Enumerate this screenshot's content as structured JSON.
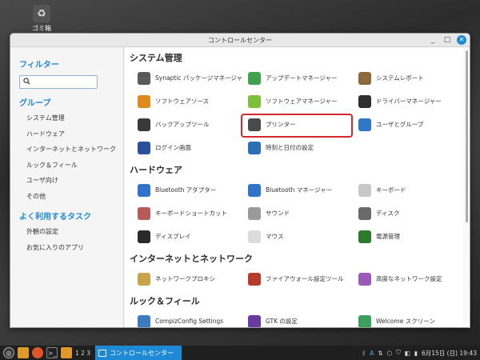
{
  "desktop": {
    "trash_label": "ゴミ箱"
  },
  "window": {
    "title": "コントロールセンター"
  },
  "sidebar": {
    "filter_heading": "フィルター",
    "search_placeholder": "",
    "group_heading": "グループ",
    "groups": [
      "システム管理",
      "ハードウェア",
      "インターネットとネットワーク",
      "ルック＆フィール",
      "ユーザ向け",
      "その他"
    ],
    "tasks_heading": "よく利用するタスク",
    "tasks": [
      "外観の設定",
      "お気に入りのアプリ"
    ]
  },
  "categories": [
    {
      "title": "システム管理",
      "items": [
        {
          "label": "Synaptic パッケージマネージャ",
          "icon": "synaptic-icon",
          "color": "#5a5a5a"
        },
        {
          "label": "アップデートマネージャー",
          "icon": "update-shield-icon",
          "color": "#3fa34d"
        },
        {
          "label": "システムレポート",
          "icon": "system-report-icon",
          "color": "#8a6a3a"
        },
        {
          "label": "ソフトウェアソース",
          "icon": "software-sources-icon",
          "color": "#e08a1e"
        },
        {
          "label": "ソフトウェアマネージャー",
          "icon": "software-manager-icon",
          "color": "#7bbf3a"
        },
        {
          "label": "ドライバーマネージャー",
          "icon": "driver-chip-icon",
          "color": "#2f2f2f"
        },
        {
          "label": "バックアップツール",
          "icon": "backup-icon",
          "color": "#3a3a3a"
        },
        {
          "label": "プリンター",
          "icon": "printer-icon",
          "color": "#4a4a4a"
        },
        {
          "label": "ユーザとグループ",
          "icon": "users-groups-icon",
          "color": "#2e78c7"
        },
        {
          "label": "ログイン画面",
          "icon": "login-screen-icon",
          "color": "#2a4f9c"
        },
        {
          "label": "時刻と日付の設定",
          "icon": "clock-icon",
          "color": "#2c6fb5"
        }
      ]
    },
    {
      "title": "ハードウェア",
      "items": [
        {
          "label": "Bluetooth アダプター",
          "icon": "bluetooth-adapter-icon",
          "color": "#2f74c9"
        },
        {
          "label": "Bluetooth マネージャー",
          "icon": "bluetooth-icon",
          "color": "#2f74c9"
        },
        {
          "label": "キーボード",
          "icon": "keyboard-icon",
          "color": "#c8c8c8"
        },
        {
          "label": "キーボードショートカット",
          "icon": "keyboard-shortcut-icon",
          "color": "#b85a5a"
        },
        {
          "label": "サウンド",
          "icon": "speaker-icon",
          "color": "#9a9a9a"
        },
        {
          "label": "ディスク",
          "icon": "disk-icon",
          "color": "#6a6a6a"
        },
        {
          "label": "ディスプレイ",
          "icon": "display-icon",
          "color": "#2a2a2a"
        },
        {
          "label": "マウス",
          "icon": "mouse-icon",
          "color": "#dcdcdc"
        },
        {
          "label": "電源管理",
          "icon": "battery-icon",
          "color": "#2d7a2d"
        }
      ]
    },
    {
      "title": "インターネットとネットワーク",
      "items": [
        {
          "label": "ネットワークプロキシ",
          "icon": "network-proxy-icon",
          "color": "#c9a34a"
        },
        {
          "label": "ファイアウォール設定ツール",
          "icon": "firewall-icon",
          "color": "#b83a2a"
        },
        {
          "label": "高度なネットワーク設定",
          "icon": "network-advanced-icon",
          "color": "#9a5ab8"
        }
      ]
    },
    {
      "title": "ルック＆フィール",
      "items": [
        {
          "label": "CompizConfig Settings",
          "icon": "compiz-icon",
          "color": "#3a7abf"
        },
        {
          "label": "GTK の設定",
          "icon": "gtk-icon",
          "color": "#6a3aa0"
        },
        {
          "label": "Welcome スクリーン",
          "icon": "welcome-icon",
          "color": "#3aa05a"
        }
      ]
    }
  ],
  "taskbar": {
    "workspaces": "1 2 3",
    "active_task": "コントロールセンター",
    "keyboard_indicator": "A",
    "clock": "6月15日 (日) 19:43"
  },
  "colors": {
    "accent": "#1e8ad6",
    "highlight": "#d42a2a"
  }
}
